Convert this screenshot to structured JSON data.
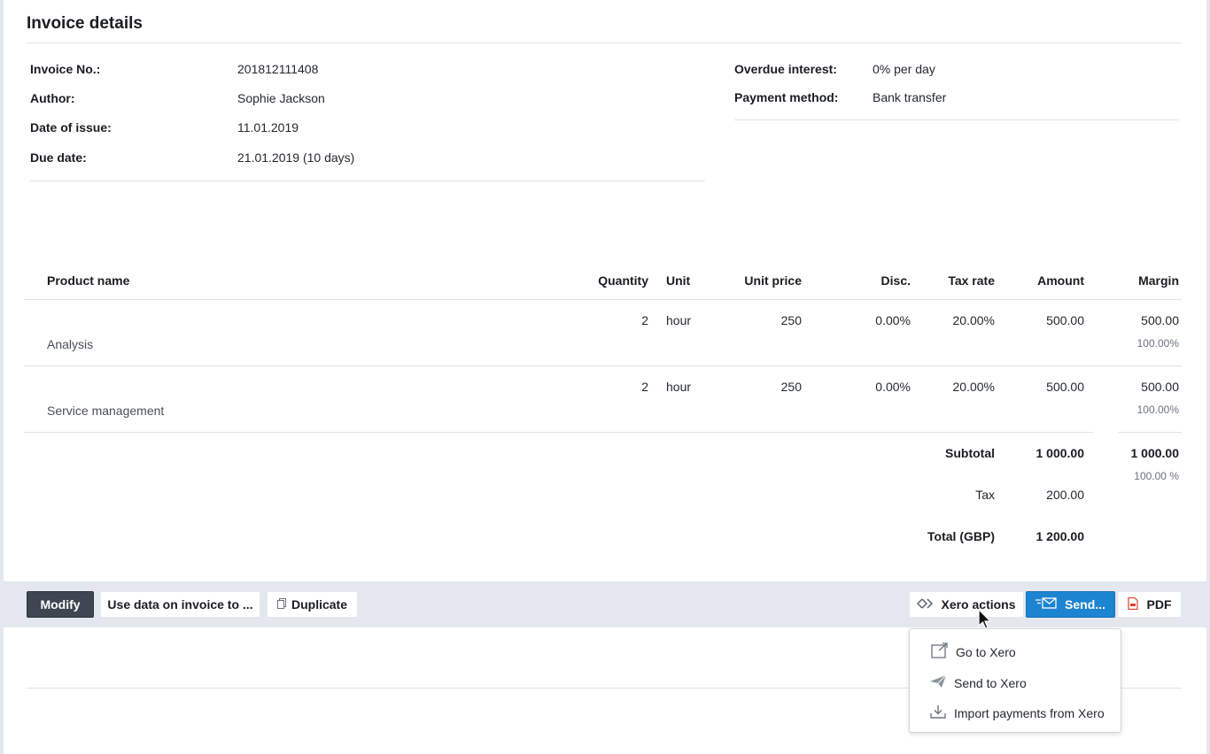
{
  "page": {
    "title": "Invoice details"
  },
  "details_left": [
    {
      "label": "Invoice No.:",
      "value": "201812111408"
    },
    {
      "label": "Author:",
      "value": "Sophie Jackson"
    },
    {
      "label": "Date of issue:",
      "value": "11.01.2019"
    },
    {
      "label": "Due date:",
      "value": "21.01.2019 (10 days)"
    }
  ],
  "details_right": [
    {
      "label": "Overdue interest:",
      "value": "0% per day"
    },
    {
      "label": "Payment method:",
      "value": "Bank transfer"
    }
  ],
  "table": {
    "headers": {
      "product": "Product name",
      "quantity": "Quantity",
      "unit": "Unit",
      "unit_price": "Unit price",
      "disc": "Disc.",
      "tax_rate": "Tax rate",
      "amount": "Amount",
      "margin": "Margin"
    },
    "rows": [
      {
        "product": "Analysis",
        "quantity": "2",
        "unit": "hour",
        "unit_price": "250",
        "disc": "0.00%",
        "tax_rate": "20.00%",
        "amount": "500.00",
        "margin": "500.00",
        "margin_pct": "100.00%"
      },
      {
        "product": "Service management",
        "quantity": "2",
        "unit": "hour",
        "unit_price": "250",
        "disc": "0.00%",
        "tax_rate": "20.00%",
        "amount": "500.00",
        "margin": "500.00",
        "margin_pct": "100.00%"
      }
    ]
  },
  "totals": {
    "subtotal_label": "Subtotal",
    "subtotal_amount": "1 000.00",
    "subtotal_margin": "1 000.00",
    "subtotal_margin_pct": "100.00 %",
    "tax_label": "Tax",
    "tax_amount": "200.00",
    "total_label": "Total (GBP)",
    "total_amount": "1 200.00"
  },
  "toolbar": {
    "modify": "Modify",
    "use_data": "Use data on invoice to ...",
    "duplicate": "Duplicate",
    "xero_actions": "Xero actions",
    "send": "Send...",
    "pdf": "PDF"
  },
  "xero_menu": {
    "items": [
      {
        "label": "Go to Xero",
        "icon": "external-link-icon"
      },
      {
        "label": "Send to Xero",
        "icon": "paper-plane-icon"
      },
      {
        "label": "Import payments from Xero",
        "icon": "download-icon"
      }
    ]
  },
  "colors": {
    "primary_blue": "#1d84d1",
    "dark_button": "#3d4651",
    "pdf_red": "#d9412e"
  }
}
